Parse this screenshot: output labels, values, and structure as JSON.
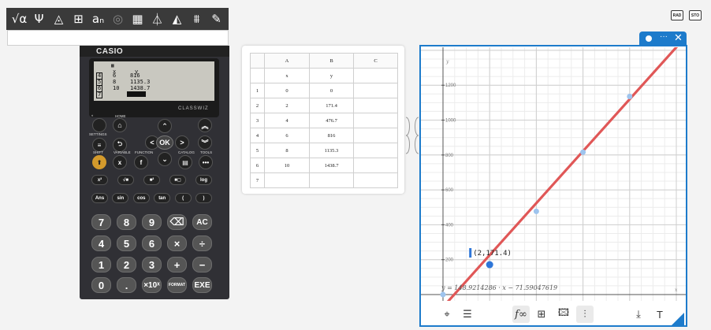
{
  "toolbar": {
    "tools": [
      {
        "icon": "sqrt-alpha-icon",
        "glyph": "√α"
      },
      {
        "icon": "psi-icon",
        "glyph": "Ψ"
      },
      {
        "icon": "geometry-icon",
        "glyph": "◬"
      },
      {
        "icon": "table-icon",
        "glyph": "⊞"
      },
      {
        "icon": "sequence-icon",
        "glyph": "aₙ"
      },
      {
        "icon": "coin-icon",
        "glyph": "◎"
      },
      {
        "icon": "calculator-icon",
        "glyph": "▦"
      },
      {
        "icon": "triangle-split-icon",
        "glyph": "⏃"
      },
      {
        "icon": "solid-geometry-icon",
        "glyph": "◭"
      },
      {
        "icon": "statistics-icon",
        "glyph": "⩩"
      },
      {
        "icon": "edit-note-icon",
        "glyph": "✎"
      }
    ]
  },
  "mode": {
    "rad": "RAD",
    "std": "STO"
  },
  "calculator": {
    "brand": "CASIO",
    "model": "CLASSWIZ",
    "screen": {
      "col_x": "x",
      "col_y": "y",
      "rows": [
        {
          "n": "4",
          "x": "6",
          "y": "816"
        },
        {
          "n": "5",
          "x": "8",
          "y": "1135.3"
        },
        {
          "n": "6",
          "x": "10",
          "y": "1438.7"
        },
        {
          "n": "7",
          "x": "",
          "y": ""
        }
      ]
    },
    "labels": {
      "settings": "SETTINGS",
      "home": "HOME",
      "shift": "SHIFT",
      "variable": "VARIABLE",
      "function": "FUNCTION",
      "catalog": "CATALOG",
      "tools": "TOOLS",
      "ok": "OK"
    },
    "rows": [
      [
        "x²",
        "√■",
        "■²",
        "■◻",
        "log"
      ],
      [
        "Ans",
        "sin",
        "cos",
        "tan",
        "(",
        ")"
      ],
      [
        "7",
        "8",
        "9",
        "⌫",
        "AC"
      ],
      [
        "4",
        "5",
        "6",
        "×",
        "÷"
      ],
      [
        "1",
        "2",
        "3",
        "+",
        "−"
      ],
      [
        "0",
        ".",
        "×10ˣ",
        "FORMAT",
        "EXE"
      ]
    ]
  },
  "table": {
    "columns": [
      "A",
      "B",
      "C"
    ],
    "header_row": [
      "x",
      "y",
      ""
    ],
    "rows": [
      {
        "n": "1",
        "A": "0",
        "B": "0",
        "C": ""
      },
      {
        "n": "2",
        "A": "2",
        "B": "171.4",
        "C": ""
      },
      {
        "n": "3",
        "A": "4",
        "B": "476.7",
        "C": ""
      },
      {
        "n": "4",
        "A": "6",
        "B": "816",
        "C": ""
      },
      {
        "n": "5",
        "A": "8",
        "B": "1135.3",
        "C": ""
      },
      {
        "n": "6",
        "A": "10",
        "B": "1438.7",
        "C": ""
      },
      {
        "n": "7",
        "A": "",
        "B": "",
        "C": ""
      }
    ]
  },
  "graph": {
    "y_axis_letter": "y",
    "x_axis_letter": "x",
    "point_label": "(2,171.4)",
    "equation": "y = 148.9214286 · x − 71.59047619",
    "footer": {
      "target": "⌖",
      "list": "☰",
      "fx": "f∞",
      "table": "⊞",
      "image": "🖾",
      "stats": "⫶",
      "download": "⤓",
      "text": "T"
    },
    "colors": {
      "accent": "#1d7bcb",
      "line": "#e05757",
      "point": "#9ec4ee",
      "highlight": "#2e76d8"
    }
  },
  "chart_data": {
    "type": "scatter",
    "x": [
      0,
      2,
      4,
      6,
      8,
      10
    ],
    "y": [
      0,
      171.4,
      476.7,
      816,
      1135.3,
      1438.7
    ],
    "ytick_labels": [
      "200",
      "400",
      "600",
      "800",
      "1000",
      "1200"
    ],
    "regression": {
      "slope": 148.9214286,
      "intercept": -71.59047619
    },
    "highlighted_point": [
      2,
      171.4
    ]
  }
}
